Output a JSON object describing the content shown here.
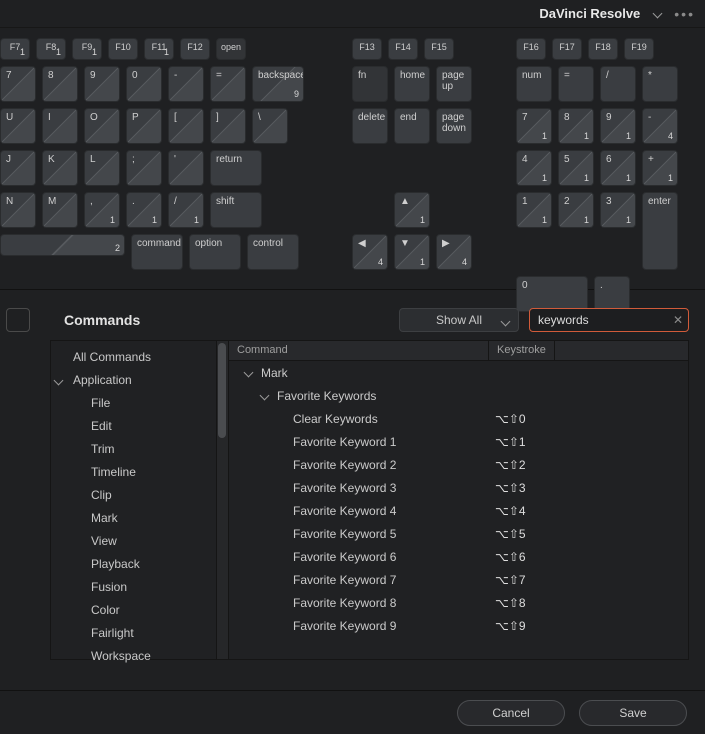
{
  "title": "DaVinci Resolve",
  "frow": [
    {
      "l": "F7",
      "c": "1"
    },
    {
      "l": "F8",
      "c": "1"
    },
    {
      "l": "F9",
      "c": "1"
    },
    {
      "l": "F10",
      "c": ""
    },
    {
      "l": "F11",
      "c": "1"
    },
    {
      "l": "F12",
      "c": ""
    },
    {
      "l": "open",
      "c": "",
      "dark": true
    }
  ],
  "frow2": [
    {
      "l": "F13"
    },
    {
      "l": "F14"
    },
    {
      "l": "F15"
    }
  ],
  "frow3": [
    {
      "l": "F16"
    },
    {
      "l": "F17"
    },
    {
      "l": "F18"
    },
    {
      "l": "F19"
    }
  ],
  "row2a": [
    {
      "l": "7",
      "d": true
    },
    {
      "l": "8",
      "d": true
    },
    {
      "l": "9",
      "d": true
    },
    {
      "l": "0",
      "d": true
    },
    {
      "l": "-",
      "d": true
    },
    {
      "l": "=",
      "d": true
    },
    {
      "l": "backspace",
      "c": "9",
      "w": "w3",
      "d": true
    }
  ],
  "row2b": [
    {
      "l": "fn",
      "dark": true
    },
    {
      "l": "home"
    },
    {
      "l": "page up"
    }
  ],
  "row2c": [
    {
      "l": "num"
    },
    {
      "l": "="
    },
    {
      "l": "/"
    },
    {
      "l": "*"
    }
  ],
  "row3a": [
    {
      "l": "U",
      "d": true
    },
    {
      "l": "I",
      "d": true
    },
    {
      "l": "O",
      "d": true
    },
    {
      "l": "P",
      "d": true
    },
    {
      "l": "[",
      "d": true
    },
    {
      "l": "]",
      "d": true
    },
    {
      "l": "\\",
      "d": true
    }
  ],
  "row3b": [
    {
      "l": "delete"
    },
    {
      "l": "end"
    },
    {
      "l": "page down"
    }
  ],
  "row3c": [
    {
      "l": "7",
      "c": "1",
      "d": true
    },
    {
      "l": "8",
      "c": "1",
      "d": true
    },
    {
      "l": "9",
      "c": "1",
      "d": true
    },
    {
      "l": "-",
      "c": "4",
      "d": true
    }
  ],
  "row4a": [
    {
      "l": "J",
      "d": true
    },
    {
      "l": "K",
      "d": true
    },
    {
      "l": "L",
      "d": true
    },
    {
      "l": ";",
      "d": true
    },
    {
      "l": "'",
      "d": true
    },
    {
      "l": "return",
      "w": "w3"
    }
  ],
  "row4c": [
    {
      "l": "4",
      "c": "1",
      "d": true
    },
    {
      "l": "5",
      "c": "1",
      "d": true
    },
    {
      "l": "6",
      "c": "1",
      "d": true
    },
    {
      "l": "+",
      "c": "1",
      "d": true
    }
  ],
  "row5a": [
    {
      "l": "N",
      "d": true
    },
    {
      "l": "M",
      "d": true
    },
    {
      "l": ",",
      "c": "1",
      "d": true
    },
    {
      "l": ".",
      "c": "1",
      "d": true
    },
    {
      "l": "/",
      "c": "1",
      "d": true
    },
    {
      "l": "shift",
      "w": "w3"
    }
  ],
  "row5b_up": {
    "l": "▲",
    "c": "1",
    "d": true
  },
  "row5c": [
    {
      "l": "1",
      "c": "1",
      "d": true
    },
    {
      "l": "2",
      "c": "1",
      "d": true
    },
    {
      "l": "3",
      "c": "1",
      "d": true
    },
    {
      "l": "enter",
      "tall": true
    }
  ],
  "row6a": [
    {
      "l": "",
      "space": true,
      "c": "2",
      "d": true
    },
    {
      "l": "command",
      "w": "w3"
    },
    {
      "l": "option",
      "w": "w3"
    },
    {
      "l": "control",
      "w": "w3"
    }
  ],
  "row6b": [
    {
      "l": "◀",
      "c": "4",
      "d": true
    },
    {
      "l": "▼",
      "c": "1",
      "d": true
    },
    {
      "l": "▶",
      "c": "4",
      "d": true
    }
  ],
  "row6c": [
    {
      "l": "0",
      "w": "w2"
    },
    {
      "l": "."
    }
  ],
  "commands_heading": "Commands",
  "showall_label": "Show All",
  "search_value": "keywords",
  "col_command": "Command",
  "col_keystroke": "Keystroke",
  "categories": {
    "all": "All Commands",
    "application": "Application",
    "subs": [
      "File",
      "Edit",
      "Trim",
      "Timeline",
      "Clip",
      "Mark",
      "View",
      "Playback",
      "Fusion",
      "Color",
      "Fairlight",
      "Workspace"
    ]
  },
  "results": {
    "group": "Mark",
    "subgroup": "Favorite Keywords",
    "items": [
      {
        "name": "Clear Keywords",
        "ks": "⌥⇧0"
      },
      {
        "name": "Favorite Keyword 1",
        "ks": "⌥⇧1"
      },
      {
        "name": "Favorite Keyword 2",
        "ks": "⌥⇧2"
      },
      {
        "name": "Favorite Keyword 3",
        "ks": "⌥⇧3"
      },
      {
        "name": "Favorite Keyword 4",
        "ks": "⌥⇧4"
      },
      {
        "name": "Favorite Keyword 5",
        "ks": "⌥⇧5"
      },
      {
        "name": "Favorite Keyword 6",
        "ks": "⌥⇧6"
      },
      {
        "name": "Favorite Keyword 7",
        "ks": "⌥⇧7"
      },
      {
        "name": "Favorite Keyword 8",
        "ks": "⌥⇧8"
      },
      {
        "name": "Favorite Keyword 9",
        "ks": "⌥⇧9"
      }
    ]
  },
  "cancel": "Cancel",
  "save": "Save"
}
